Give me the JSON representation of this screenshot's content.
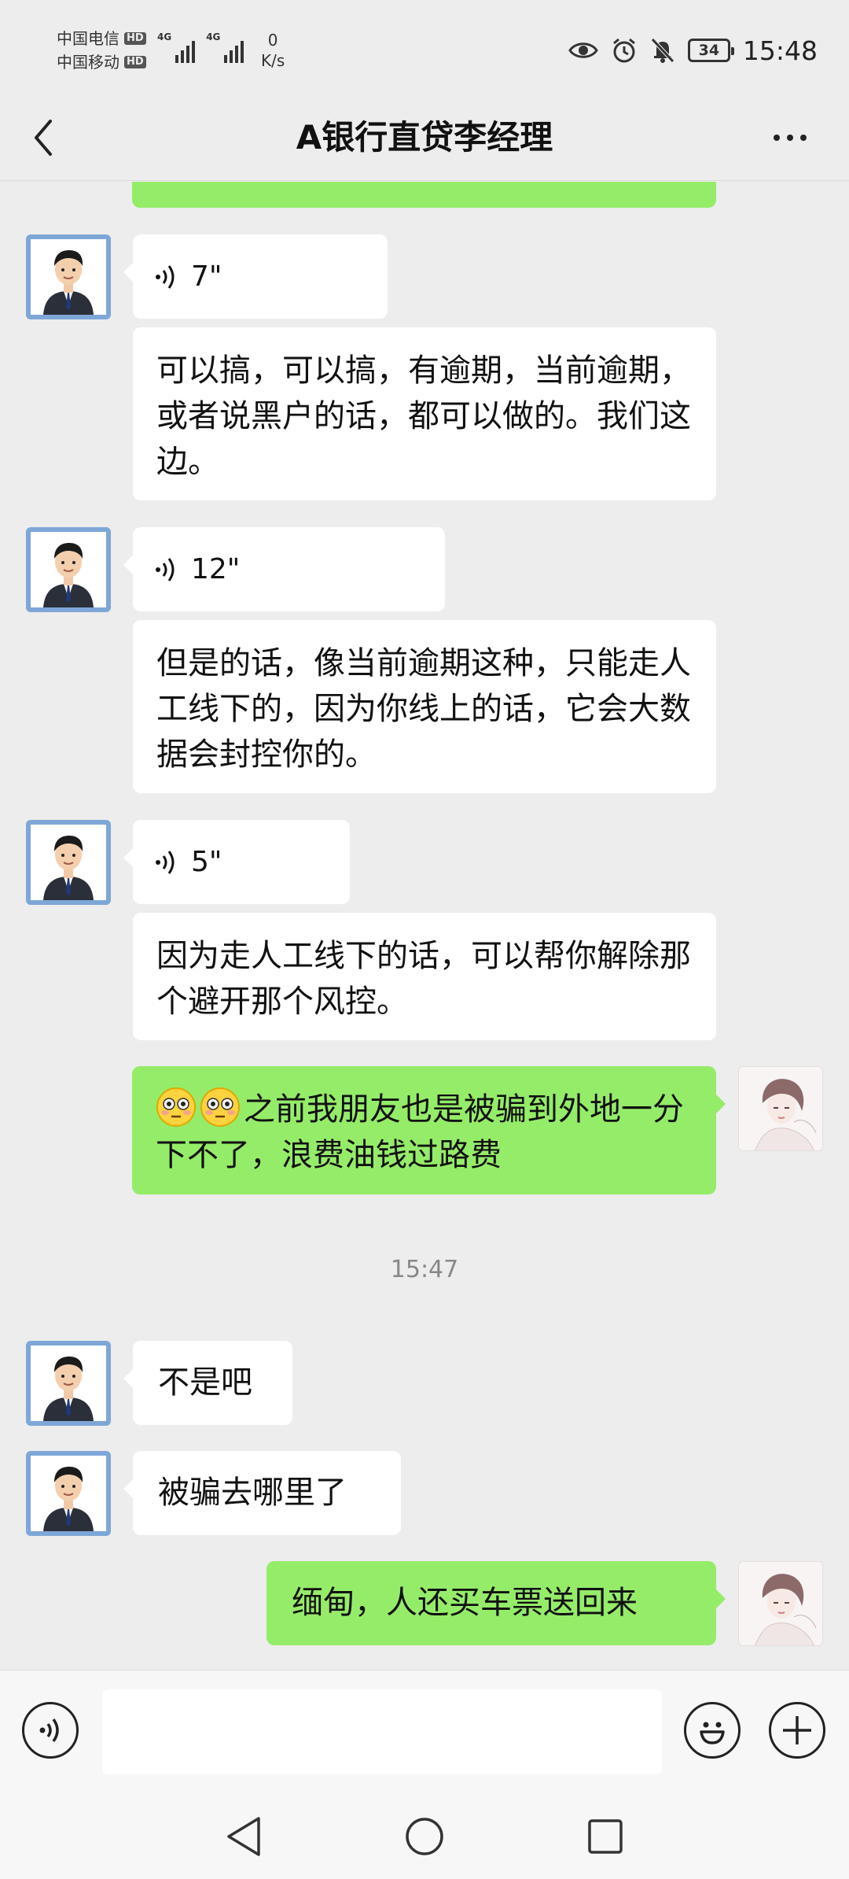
{
  "status_bar": {
    "carrier1": "中国电信",
    "carrier2": "中国移动",
    "hd_badge": "HD",
    "network1": "4G",
    "network2": "4G",
    "net_speed_value": "0",
    "net_speed_unit": "K/s",
    "battery_level": "34",
    "time": "15:48"
  },
  "header": {
    "title": "A银行直贷李经理",
    "back_icon": "chevron-left-icon",
    "more_icon": "more-dots-icon"
  },
  "messages": [
    {
      "sender": "me",
      "type": "text",
      "text": ""
    },
    {
      "sender": "manager",
      "type": "voice",
      "duration": "7\""
    },
    {
      "sender": "manager",
      "type": "text",
      "text": "可以搞，可以搞，有逾期，当前逾期，或者说黑户的话，都可以做的。我们这边。"
    },
    {
      "sender": "manager",
      "type": "voice",
      "duration": "12\""
    },
    {
      "sender": "manager",
      "type": "text",
      "text": "但是的话，像当前逾期这种，只能走人工线下的，因为你线上的话，它会大数据会封控你的。"
    },
    {
      "sender": "manager",
      "type": "voice",
      "duration": "5\""
    },
    {
      "sender": "manager",
      "type": "text",
      "text": "因为走人工线下的话，可以帮你解除那个避开那个风控。"
    },
    {
      "sender": "me",
      "type": "text",
      "emoji_count": 2,
      "text": "之前我朋友也是被骗到外地一分下不了，浪费油钱过路费"
    },
    {
      "sender": "system",
      "type": "timestamp",
      "text": "15:47"
    },
    {
      "sender": "manager",
      "type": "text",
      "text": "不是吧"
    },
    {
      "sender": "manager",
      "type": "text",
      "text": "被骗去哪里了"
    },
    {
      "sender": "me",
      "type": "text",
      "text": "缅甸，人还买车票送回来"
    }
  ],
  "input_bar": {
    "voice_icon": "voice-mode-icon",
    "emoji_icon": "emoji-icon",
    "plus_icon": "plus-icon",
    "input_value": ""
  },
  "system_nav": [
    "back-triangle-icon",
    "home-circle-icon",
    "recents-square-icon"
  ],
  "colors": {
    "background": "#ededed",
    "incoming_bubble": "#ffffff",
    "outgoing_bubble": "#95ec69",
    "manager_avatar_bg": "#7ea7d8"
  }
}
